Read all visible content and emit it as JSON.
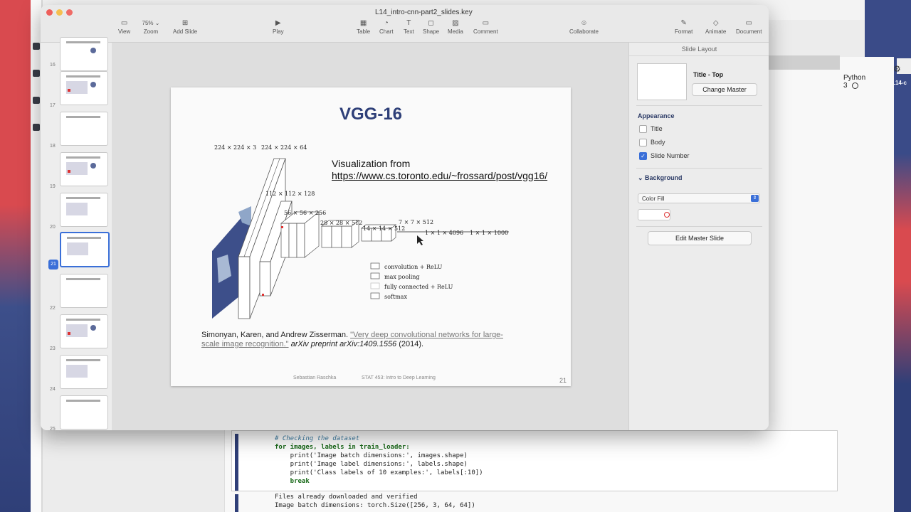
{
  "window": {
    "title": "L14_intro-cnn-part2_slides.key"
  },
  "toolbar": {
    "view": "View",
    "zoom_value": "75%",
    "zoom": "Zoom",
    "add_slide": "Add Slide",
    "play": "Play",
    "table": "Table",
    "chart": "Chart",
    "text": "Text",
    "shape": "Shape",
    "media": "Media",
    "comment": "Comment",
    "collaborate": "Collaborate",
    "format": "Format",
    "animate": "Animate",
    "document": "Document"
  },
  "navigator": {
    "slides": [
      {
        "num": "16"
      },
      {
        "num": "17"
      },
      {
        "num": "18"
      },
      {
        "num": "19"
      },
      {
        "num": "20"
      },
      {
        "num": "21"
      },
      {
        "num": "22"
      },
      {
        "num": "23"
      },
      {
        "num": "24"
      },
      {
        "num": "25"
      }
    ],
    "active": "21"
  },
  "slide": {
    "title": "VGG-16",
    "viz_line1": "Visualization from",
    "viz_link": "https://www.cs.toronto.edu/~frossard/post/vgg16/",
    "layer_labels": {
      "l1": "224 × 224 × 3",
      "l2": "224 × 224 × 64",
      "l3": "112 × 112 × 128",
      "l4": "56 × 56 × 256",
      "l5": "28 × 28 × 512",
      "l6": "14 × 14 × 512",
      "l7": "7 × 7 × 512",
      "l8": "1 × 1 × 4096",
      "l9": "1 × 1 × 1000"
    },
    "legend": {
      "conv": "convolution + ReLU",
      "pool": "max pooling",
      "fc": "fully connected + ReLU",
      "softmax": "softmax"
    },
    "citation": {
      "authors": "Simonyan, Karen, and Andrew Zisserman.",
      "paper": "\"Very deep convolutional networks for large-scale image recognition.\"",
      "venue": "arXiv preprint arXiv:1409.1556",
      "year": "(2014)."
    },
    "footer_author": "Sebastian Raschka",
    "footer_course": "STAT 453: Intro to Deep Learning",
    "number": "21"
  },
  "inspector": {
    "header": "Slide Layout",
    "layout_name": "Title - Top",
    "change_master": "Change Master",
    "appearance": "Appearance",
    "title": "Title",
    "body": "Body",
    "slide_number": "Slide Number",
    "slide_number_checked": true,
    "background": "Background",
    "fill": "Color Fill",
    "edit_master": "Edit Master Slide"
  },
  "jupyter": {
    "kernel": "Python 3",
    "code": [
      "# Checking the dataset",
      "for images, labels in train_loader:",
      "    print('Image batch dimensions:', images.shape)",
      "    print('Image label dimensions:', labels.shape)",
      "    print('Class labels of 10 examples:', labels[:10])",
      "    break"
    ],
    "output": [
      "Files already downloaded and verified",
      "Image batch dimensions: torch.Size([256, 3, 64, 64])"
    ]
  },
  "desktop": {
    "right_label": "L14-c"
  },
  "colors": {
    "accent": "#3a6fd8",
    "title_blue": "#2e3f78",
    "red": "#d94a4f",
    "navy": "#2f3f78"
  }
}
